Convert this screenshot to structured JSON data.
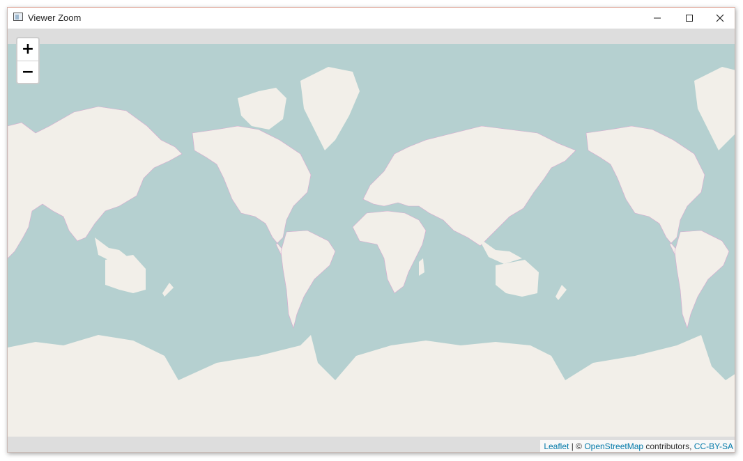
{
  "window": {
    "title": "Viewer Zoom",
    "minimize_icon": "minimize-icon",
    "maximize_icon": "maximize-icon",
    "close_icon": "close-icon"
  },
  "map": {
    "zoom_in_label": "+",
    "zoom_out_label": "−",
    "colors": {
      "water": "#b5d0d0",
      "land": "#f2efe9",
      "borders": "#d9a8cf",
      "background": "#dddddd"
    }
  },
  "attribution": {
    "leaflet": "Leaflet",
    "separator": " | © ",
    "osm": "OpenStreetMap",
    "contributors": " contributors, ",
    "license": "CC-BY-SA"
  }
}
